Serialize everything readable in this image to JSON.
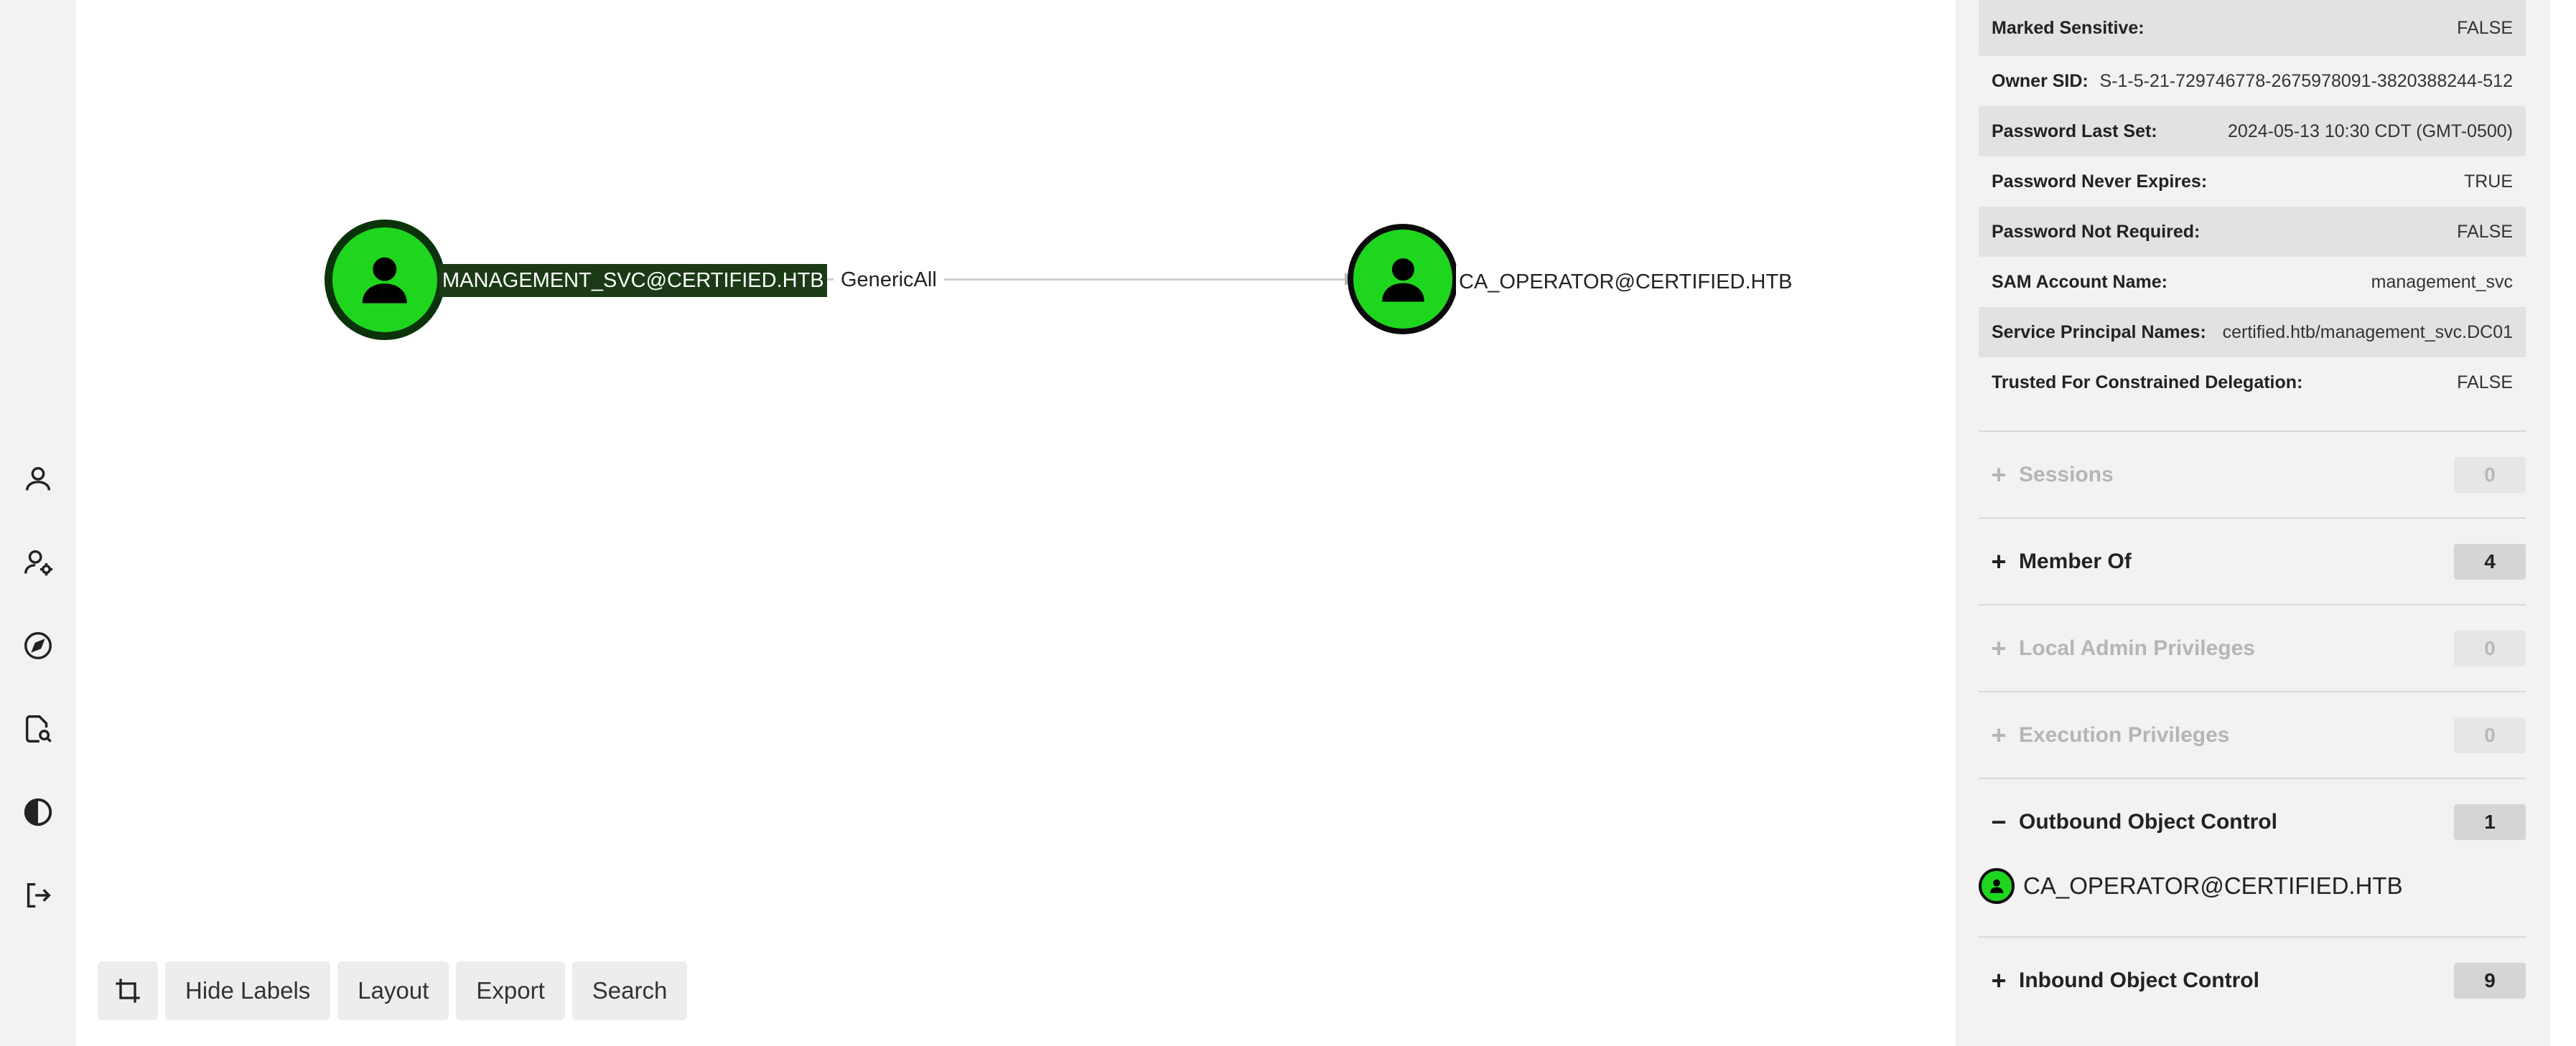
{
  "rail": {
    "items": [
      {
        "icon": "user-icon"
      },
      {
        "icon": "user-settings-icon"
      },
      {
        "icon": "compass-icon"
      },
      {
        "icon": "document-search-icon"
      },
      {
        "icon": "contrast-icon"
      },
      {
        "icon": "logout-icon"
      }
    ]
  },
  "graph": {
    "source_node": {
      "label": "MANAGEMENT_SVC@CERTIFIED.HTB",
      "icon": "user-icon",
      "color": "#1fd61f"
    },
    "target_node": {
      "label": "CA_OPERATOR@CERTIFIED.HTB",
      "icon": "user-icon",
      "color": "#1fd61f"
    },
    "edge": {
      "label": "GenericAll"
    }
  },
  "toolbar": {
    "crop_icon": "crop-icon",
    "hide_labels": "Hide Labels",
    "layout": "Layout",
    "export": "Export",
    "search": "Search"
  },
  "panel": {
    "properties": [
      {
        "key": "Marked Sensitive:",
        "value": "FALSE"
      },
      {
        "key": "Owner SID:",
        "value": "S-1-5-21-729746778-2675978091-3820388244-512"
      },
      {
        "key": "Password Last Set:",
        "value": "2024-05-13 10:30 CDT (GMT-0500)"
      },
      {
        "key": "Password Never Expires:",
        "value": "TRUE"
      },
      {
        "key": "Password Not Required:",
        "value": "FALSE"
      },
      {
        "key": "SAM Account Name:",
        "value": "management_svc"
      },
      {
        "key": "Service Principal Names:",
        "value": "certified.htb/management_svc.DC01"
      },
      {
        "key": "Trusted For Constrained Delegation:",
        "value": "FALSE"
      }
    ],
    "sections": [
      {
        "sign": "+",
        "label": "Sessions",
        "count": "0",
        "enabled": false
      },
      {
        "sign": "+",
        "label": "Member Of",
        "count": "4",
        "enabled": true
      },
      {
        "sign": "+",
        "label": "Local Admin Privileges",
        "count": "0",
        "enabled": false
      },
      {
        "sign": "+",
        "label": "Execution Privileges",
        "count": "0",
        "enabled": false
      },
      {
        "sign": "−",
        "label": "Outbound Object Control",
        "count": "1",
        "enabled": true
      },
      {
        "sign": "+",
        "label": "Inbound Object Control",
        "count": "9",
        "enabled": true
      }
    ],
    "outbound_item": {
      "label": "CA_OPERATOR@CERTIFIED.HTB",
      "icon": "user-icon"
    }
  },
  "colors": {
    "node_fill": "#1fd61f",
    "node_label_highlight": "#1c3a16",
    "panel_bg": "#f2f2f2",
    "count_badge": "#d5d5d5"
  }
}
